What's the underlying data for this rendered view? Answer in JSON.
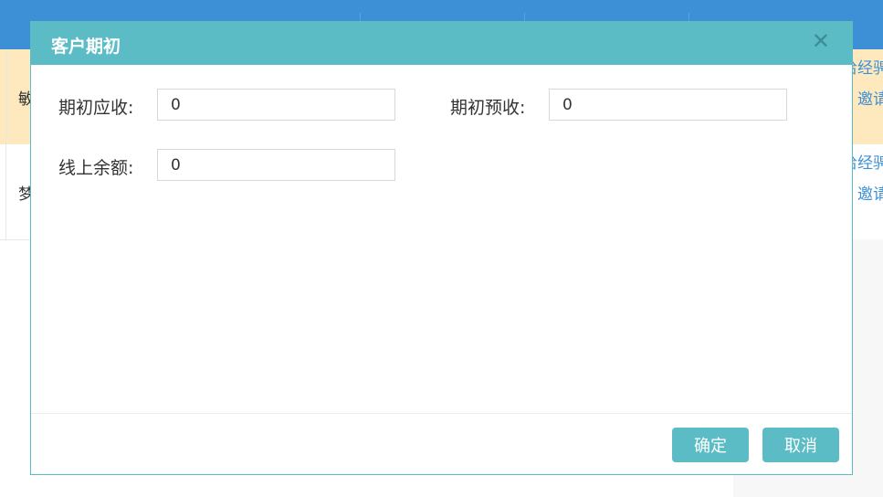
{
  "background": {
    "rows": [
      {
        "cell_text": "敏",
        "link1": "给经骋",
        "link2": "| 邀请"
      },
      {
        "cell_text": "梦",
        "link1": "给经骋",
        "link2": "| 邀请"
      }
    ]
  },
  "modal": {
    "title": "客户期初",
    "close_symbol": "✕",
    "fields": {
      "receivable": {
        "label": "期初应收:",
        "value": "0"
      },
      "prepaid": {
        "label": "期初预收:",
        "value": "0"
      },
      "online_balance": {
        "label": "线上余额:",
        "value": "0"
      }
    },
    "buttons": {
      "confirm": "确定",
      "cancel": "取消"
    }
  },
  "colors": {
    "accent": "#5bbcc6",
    "header_bg": "#3d8fd6",
    "highlight_row": "#fde9bd",
    "link": "#3d8fd6"
  }
}
